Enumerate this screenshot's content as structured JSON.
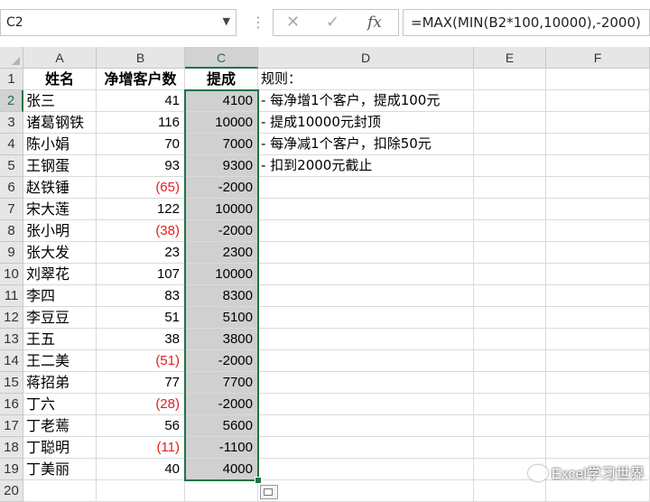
{
  "formula_bar": {
    "name_box": "C2",
    "formula": "=MAX(MIN(B2*100,10000),-2000)",
    "icons": [
      "cancel-icon",
      "enter-check-icon",
      "fx-icon"
    ]
  },
  "columns": [
    "A",
    "B",
    "C",
    "D",
    "E",
    "F"
  ],
  "rows": [
    "1",
    "2",
    "3",
    "4",
    "5",
    "6",
    "7",
    "8",
    "9",
    "10",
    "11",
    "12",
    "13",
    "14",
    "15",
    "16",
    "17",
    "18",
    "19",
    "20"
  ],
  "headers": {
    "name": "姓名",
    "clients": "净增客户数",
    "commission": "提成"
  },
  "data": [
    {
      "name": "张三",
      "clients": "41",
      "commission": "4100",
      "neg": false
    },
    {
      "name": "诸葛钢铁",
      "clients": "116",
      "commission": "10000",
      "neg": false
    },
    {
      "name": "陈小娟",
      "clients": "70",
      "commission": "7000",
      "neg": false
    },
    {
      "name": "王钢蛋",
      "clients": "93",
      "commission": "9300",
      "neg": false
    },
    {
      "name": "赵铁锤",
      "clients": "(65)",
      "commission": "-2000",
      "neg": true
    },
    {
      "name": "宋大莲",
      "clients": "122",
      "commission": "10000",
      "neg": false
    },
    {
      "name": "张小明",
      "clients": "(38)",
      "commission": "-2000",
      "neg": true
    },
    {
      "name": "张大发",
      "clients": "23",
      "commission": "2300",
      "neg": false
    },
    {
      "name": "刘翠花",
      "clients": "107",
      "commission": "10000",
      "neg": false
    },
    {
      "name": "李四",
      "clients": "83",
      "commission": "8300",
      "neg": false
    },
    {
      "name": "李豆豆",
      "clients": "51",
      "commission": "5100",
      "neg": false
    },
    {
      "name": "王五",
      "clients": "38",
      "commission": "3800",
      "neg": false
    },
    {
      "name": "王二美",
      "clients": "(51)",
      "commission": "-2000",
      "neg": true
    },
    {
      "name": "蒋招弟",
      "clients": "77",
      "commission": "7700",
      "neg": false
    },
    {
      "name": "丁六",
      "clients": "(28)",
      "commission": "-2000",
      "neg": true
    },
    {
      "name": "丁老蔫",
      "clients": "56",
      "commission": "5600",
      "neg": false
    },
    {
      "name": "丁聪明",
      "clients": "(11)",
      "commission": "-1100",
      "neg": true
    },
    {
      "name": "丁美丽",
      "clients": "40",
      "commission": "4000",
      "neg": false
    }
  ],
  "rules": [
    "规则：",
    "- 每净增1个客户，提成100元",
    "- 提成10000元封顶",
    "- 每净减1个客户，扣除50元",
    "- 扣到2000元截止"
  ],
  "selection": {
    "active_column": "C",
    "active_row": "2"
  },
  "watermark": "Excel学习世界",
  "colors": {
    "accent": "#217346",
    "negative": "#e0201c",
    "selection_fill": "#d0d0d0"
  }
}
